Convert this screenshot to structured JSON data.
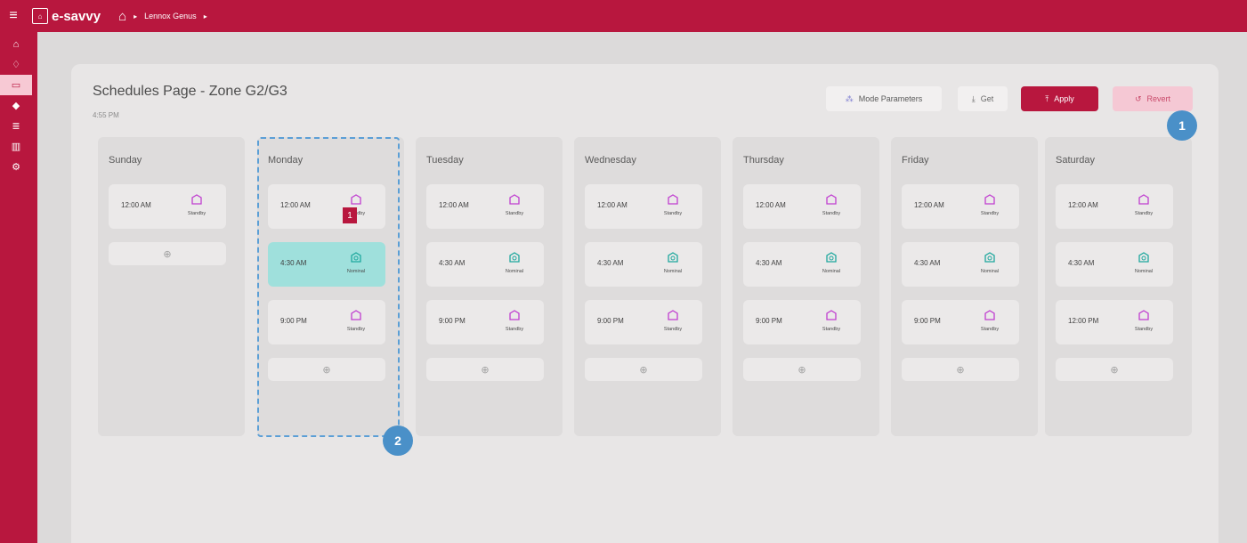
{
  "topbar": {
    "logo_text": "e-savvy",
    "breadcrumb": "Lennox Genus"
  },
  "page": {
    "title": "Schedules Page - Zone G2/G3",
    "time": "4:55 PM"
  },
  "buttons": {
    "mode": "Mode Parameters",
    "get": "Get",
    "apply": "Apply",
    "revert": "Revert"
  },
  "days": [
    {
      "name": "Sunday",
      "slots": [
        {
          "time": "12:00 AM",
          "mode": "Standby"
        }
      ]
    },
    {
      "name": "Monday",
      "slots": [
        {
          "time": "12:00 AM",
          "mode": "Standby"
        },
        {
          "time": "4:30 AM",
          "mode": "Nominal"
        },
        {
          "time": "9:00 PM",
          "mode": "Standby"
        }
      ]
    },
    {
      "name": "Tuesday",
      "slots": [
        {
          "time": "12:00 AM",
          "mode": "Standby"
        },
        {
          "time": "4:30 AM",
          "mode": "Nominal"
        },
        {
          "time": "9:00 PM",
          "mode": "Standby"
        }
      ]
    },
    {
      "name": "Wednesday",
      "slots": [
        {
          "time": "12:00 AM",
          "mode": "Standby"
        },
        {
          "time": "4:30 AM",
          "mode": "Nominal"
        },
        {
          "time": "9:00 PM",
          "mode": "Standby"
        }
      ]
    },
    {
      "name": "Thursday",
      "slots": [
        {
          "time": "12:00 AM",
          "mode": "Standby"
        },
        {
          "time": "4:30 AM",
          "mode": "Nominal"
        },
        {
          "time": "9:00 PM",
          "mode": "Standby"
        }
      ]
    },
    {
      "name": "Friday",
      "slots": [
        {
          "time": "12:00 AM",
          "mode": "Standby"
        },
        {
          "time": "4:30 AM",
          "mode": "Nominal"
        },
        {
          "time": "9:00 PM",
          "mode": "Standby"
        }
      ]
    },
    {
      "name": "Saturday",
      "slots": [
        {
          "time": "12:00 AM",
          "mode": "Standby"
        },
        {
          "time": "4:30 AM",
          "mode": "Nominal"
        },
        {
          "time": "12:00 PM",
          "mode": "Standby"
        }
      ]
    }
  ],
  "annotations": {
    "callout_1": "1",
    "callout_2": "2",
    "tag_1": "1"
  },
  "colors": {
    "brand": "#b8173e",
    "standby_icon": "#c03fd0",
    "nominal_icon": "#1fa89e",
    "selected_slot": "#9fe0dc",
    "callout": "#4a90c8"
  }
}
